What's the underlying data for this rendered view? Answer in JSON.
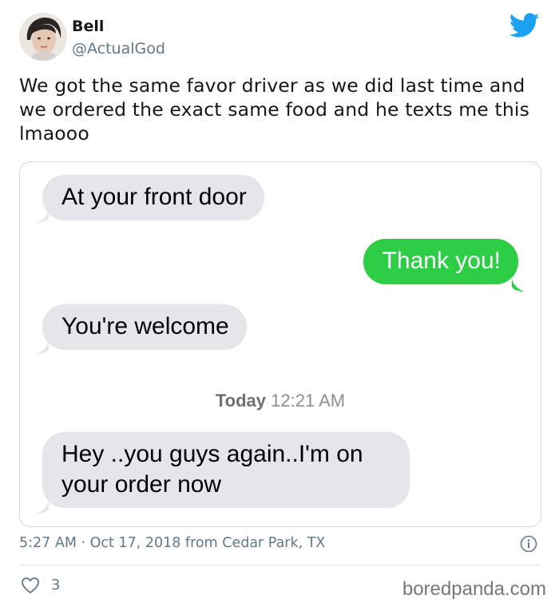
{
  "author": {
    "name": "Bell",
    "handle": "@ActualGod"
  },
  "brand": {
    "icon": "twitter-bird-icon",
    "color": "#1da1f2"
  },
  "tweet": {
    "text": "We got the same favor driver as we did last time and we ordered the exact same food and he texts me this lmaooo"
  },
  "screenshot": {
    "messages": [
      {
        "from": "them",
        "text": "At your front door"
      },
      {
        "from": "me",
        "text": "Thank you!"
      },
      {
        "from": "them",
        "text": "You're welcome"
      },
      {
        "from": "them",
        "text": "Hey ..you guys again..I'm on your order now"
      }
    ],
    "timestamp": {
      "day": "Today",
      "time": "12:21 AM"
    },
    "colors": {
      "incoming": "#e5e5ea",
      "outgoing": "#2dcd46"
    }
  },
  "meta": {
    "text": "5:27 AM · Oct 17, 2018 from Cedar Park, TX"
  },
  "actions": {
    "likes": "3"
  },
  "watermark": "boredpanda.com"
}
